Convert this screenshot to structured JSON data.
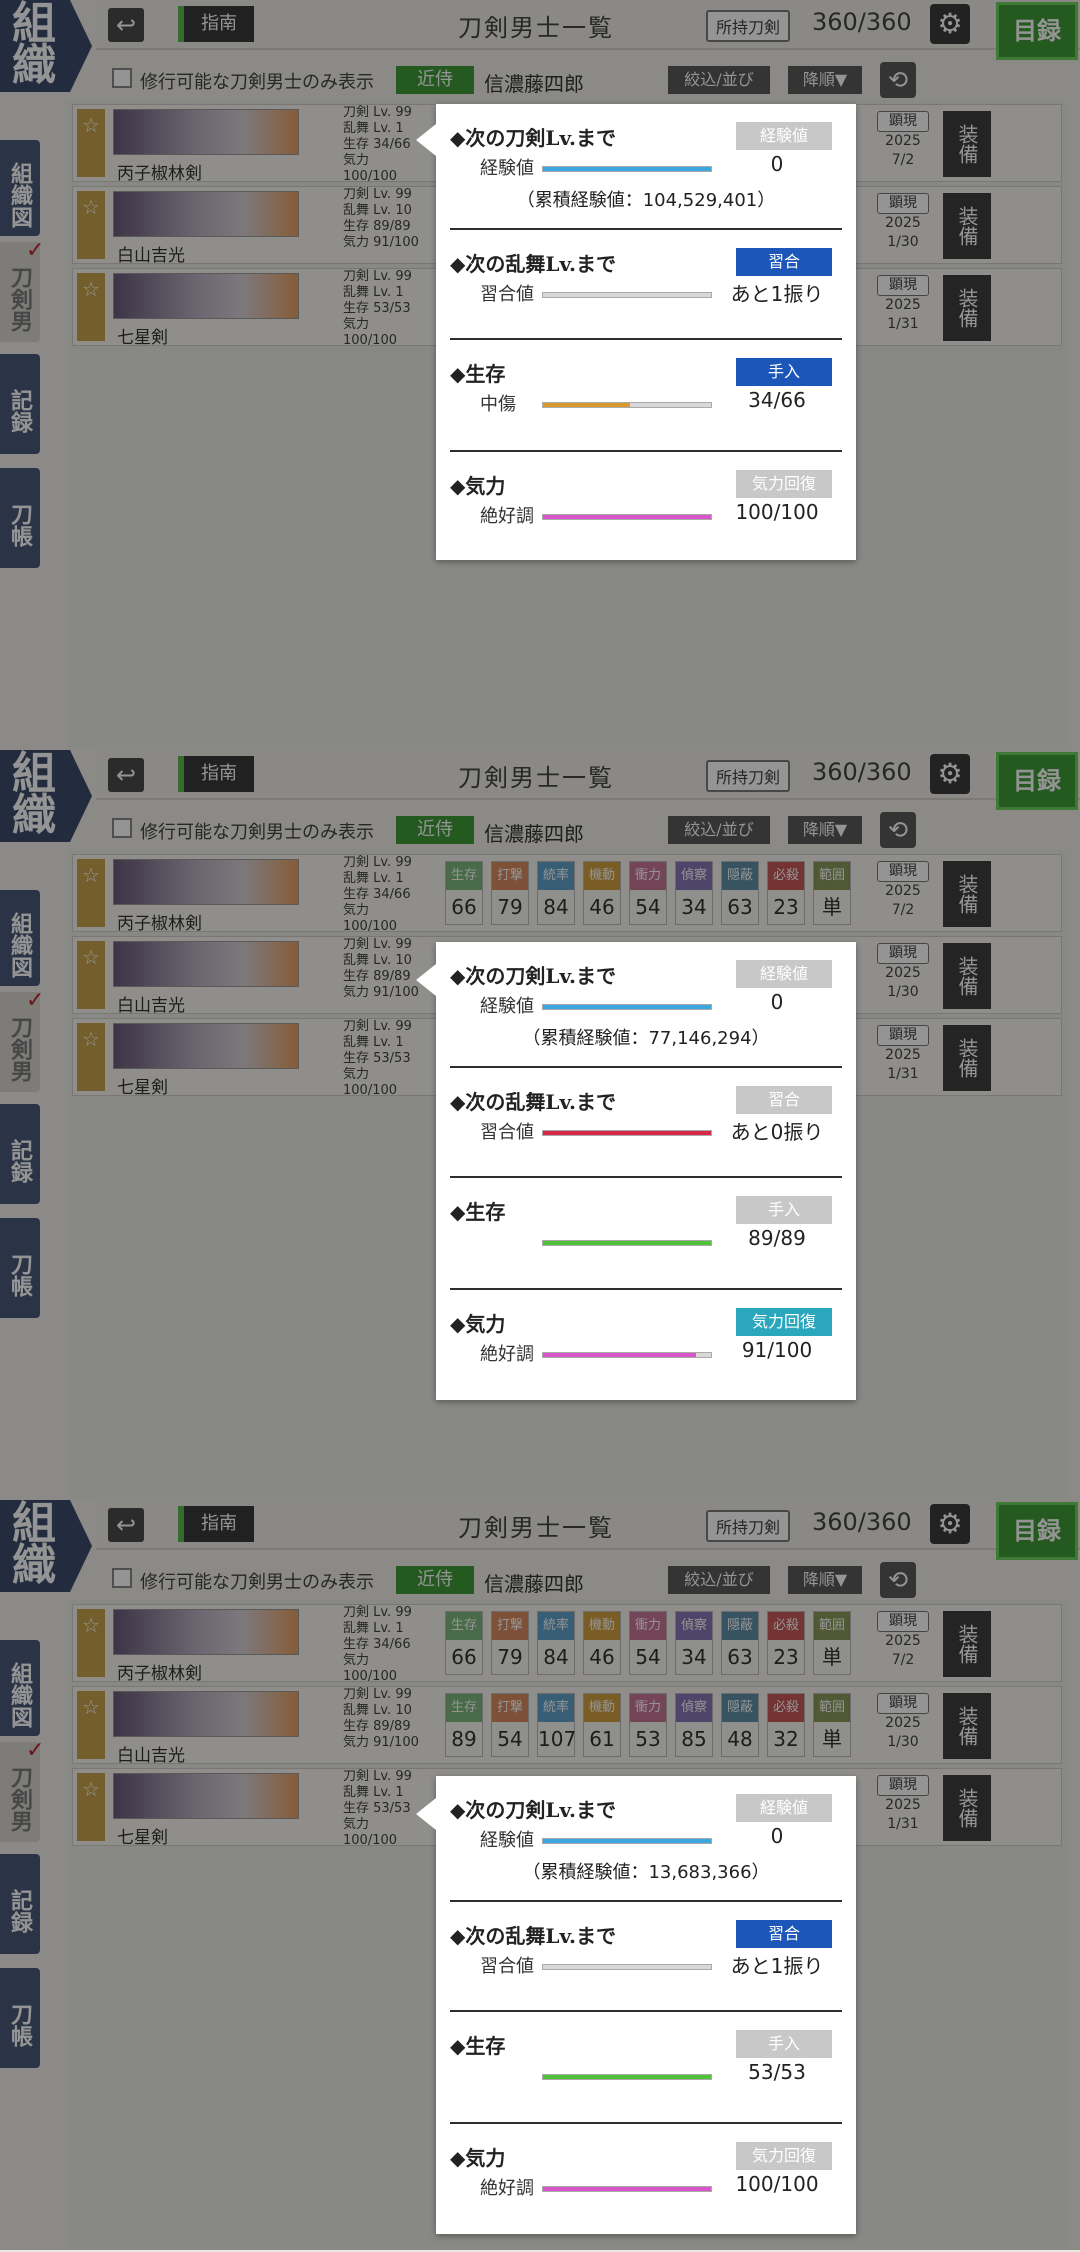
{
  "brand": {
    "line1": "組",
    "line2": "織"
  },
  "side_nav": [
    {
      "label": "組織図"
    },
    {
      "label": "刀剣男士"
    },
    {
      "label": "記録"
    },
    {
      "label": "刀帳"
    }
  ],
  "topbar": {
    "back_icon": "↩",
    "guide": "指南",
    "title": "刀剣男士一覧",
    "owned_label": "所持刀剣",
    "owned_count": "360/360",
    "gear_icon": "⚙",
    "catalog": "目録"
  },
  "filter": {
    "checkbox_label": "修行可能な刀剣男士のみ表示",
    "kinji_tag": "近侍",
    "kinji_name": "信濃藤四郎",
    "filter_btn": "絞込/並び",
    "sort_btn": "降順▼",
    "refresh_icon": "⟲"
  },
  "param_headers": [
    "生存",
    "打撃",
    "統率",
    "機動",
    "衝力",
    "偵察",
    "隠蔽",
    "必殺",
    "範囲"
  ],
  "param_colors": [
    "#7fb87f",
    "#d98b5f",
    "#5fa3c8",
    "#d0a040",
    "#c87898",
    "#8878b8",
    "#6090a8",
    "#c85a5a",
    "#8a9a5a"
  ],
  "swords": [
    {
      "name": "丙子椒林剣",
      "stats": [
        "刀剣 Lv. 99",
        "乱舞 Lv. 1",
        "生存 34/66",
        "気力 100/100"
      ],
      "params": [
        "66",
        "79",
        "84",
        "46",
        "54",
        "34",
        "63",
        "23",
        "単"
      ],
      "appear": {
        "tag": "顕現",
        "year": "2025",
        "date": "7/2"
      },
      "equip": "装備"
    },
    {
      "name": "白山吉光",
      "stats": [
        "刀剣 Lv. 99",
        "乱舞 Lv. 10",
        "生存 89/89",
        "気力 91/100"
      ],
      "params": [
        "89",
        "54",
        "107",
        "61",
        "53",
        "85",
        "48",
        "32",
        "単"
      ],
      "appear": {
        "tag": "顕現",
        "year": "2025",
        "date": "1/30"
      },
      "equip": "装備"
    },
    {
      "name": "七星剣",
      "stats": [
        "刀剣 Lv. 99",
        "乱舞 Lv. 1",
        "生存 53/53",
        "気力 100/100"
      ],
      "params": [
        "",
        "",
        "",
        "",
        "",
        "",
        "",
        "",
        ""
      ],
      "appear": {
        "tag": "顕現",
        "year": "2025",
        "date": "1/31"
      },
      "equip": "装備"
    }
  ],
  "popups": [
    {
      "exp_title": "◆次の刀剣Lv.まで",
      "exp_btn": "経験値",
      "exp_label": "経験値",
      "exp_value": "0",
      "exp_fill": 1.0,
      "exp_total": "（累積経験値：104,529,401）",
      "ranbu_title": "◆次の乱舞Lv.まで",
      "ranbu_btn": "習合",
      "ranbu_label": "習合値",
      "ranbu_value": "あと1振り",
      "ranbu_fill": 0.0,
      "ranbu_color": "#cccccc",
      "hp_title": "◆生存",
      "hp_btn": "手入",
      "hp_label": "中傷",
      "hp_value": "34/66",
      "hp_fill": 0.515,
      "hp_color": "#d89a2e",
      "fatigue_title": "◆気力",
      "fatigue_btn": "気力回復",
      "fatigue_label": "絶好調",
      "fatigue_value": "100/100",
      "fatigue_fill": 1.0
    },
    {
      "exp_title": "◆次の刀剣Lv.まで",
      "exp_btn": "経験値",
      "exp_label": "経験値",
      "exp_value": "0",
      "exp_fill": 1.0,
      "exp_total": "（累積経験値：77,146,294）",
      "ranbu_title": "◆次の乱舞Lv.まで",
      "ranbu_btn": "習合",
      "ranbu_label": "習合値",
      "ranbu_value": "あと0振り",
      "ranbu_fill": 1.0,
      "ranbu_color": "#d8284a",
      "hp_title": "◆生存",
      "hp_btn": "手入",
      "hp_label": "",
      "hp_value": "89/89",
      "hp_fill": 1.0,
      "hp_color": "#52c13a",
      "fatigue_title": "◆気力",
      "fatigue_btn": "気力回復",
      "fatigue_label": "絶好調",
      "fatigue_value": "91/100",
      "fatigue_fill": 0.91
    },
    {
      "exp_title": "◆次の刀剣Lv.まで",
      "exp_btn": "経験値",
      "exp_label": "経験値",
      "exp_value": "0",
      "exp_fill": 1.0,
      "exp_total": "（累積経験値：13,683,366）",
      "ranbu_title": "◆次の乱舞Lv.まで",
      "ranbu_btn": "習合",
      "ranbu_label": "習合値",
      "ranbu_value": "あと1振り",
      "ranbu_fill": 0.0,
      "ranbu_color": "#cccccc",
      "hp_title": "◆生存",
      "hp_btn": "手入",
      "hp_label": "",
      "hp_value": "53/53",
      "hp_fill": 1.0,
      "hp_color": "#52c13a",
      "fatigue_title": "◆気力",
      "fatigue_btn": "気力回復",
      "fatigue_label": "絶好調",
      "fatigue_value": "100/100",
      "fatigue_fill": 1.0
    }
  ],
  "colors": {
    "exp_bar": "#3ea6df",
    "fatigue_bar": "#d855c8",
    "btn_active_blue": "#1c56b8",
    "btn_active_teal": "#2aa7bd",
    "btn_inactive": "#c8c8c8"
  }
}
